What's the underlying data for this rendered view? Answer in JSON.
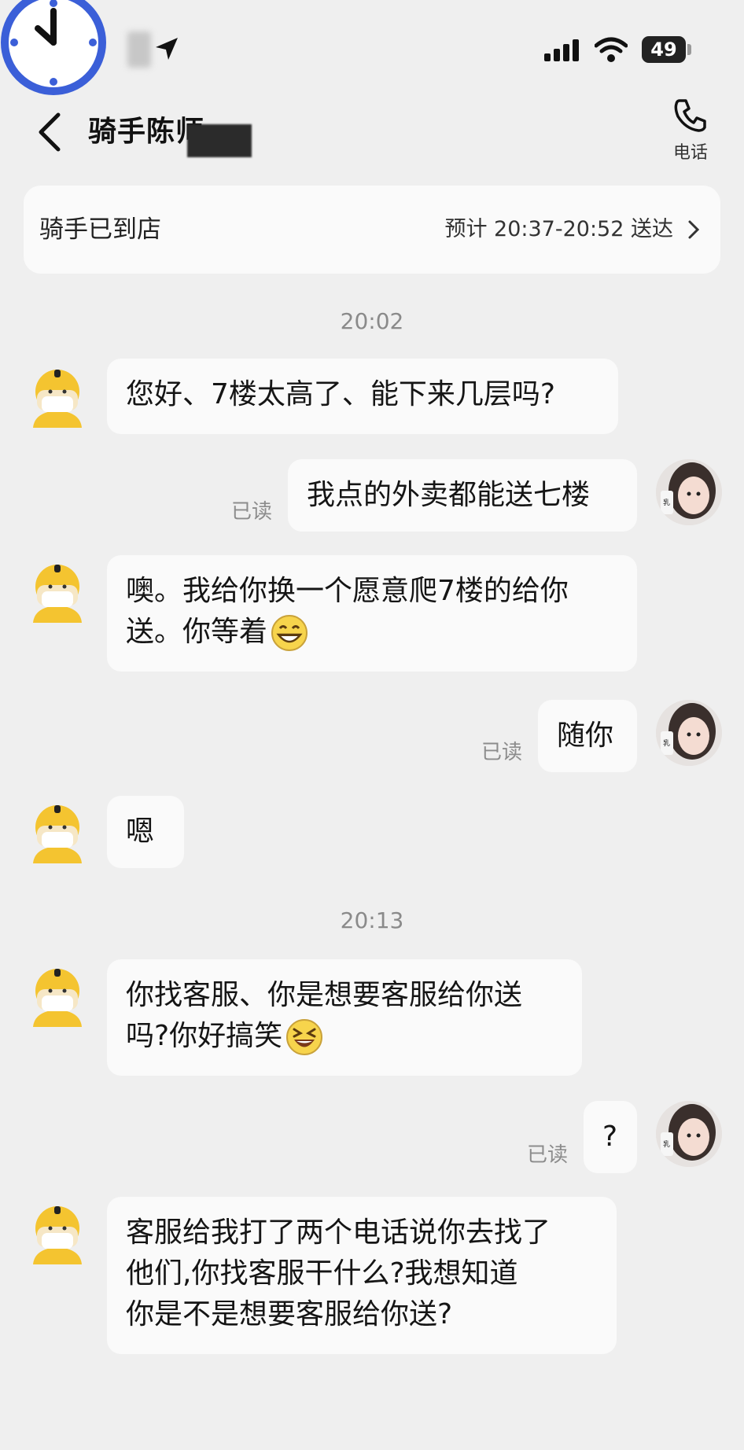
{
  "status_bar": {
    "battery": "49",
    "icons": [
      "clock-icon",
      "location-arrow-icon",
      "signal-icon",
      "wifi-icon",
      "battery-icon"
    ]
  },
  "header": {
    "title": "骑手陈师",
    "phone_label": "电话"
  },
  "status_card": {
    "status": "骑手已到店",
    "eta": "预计 20:37-20:52 送达"
  },
  "messages": [
    {
      "type": "time",
      "text": "20:02"
    },
    {
      "type": "rider",
      "text": "您好、7楼太高了、能下来几层吗?"
    },
    {
      "type": "user",
      "text": "我点的外卖都能送七楼",
      "read": "已读"
    },
    {
      "type": "rider",
      "line1": "噢。我给你换一个愿意爬7楼的给你",
      "line2": "送。你等着",
      "emoji": "grin-emoji"
    },
    {
      "type": "user",
      "text": "随你",
      "read": "已读"
    },
    {
      "type": "rider",
      "text": "嗯"
    },
    {
      "type": "time",
      "text": "20:13"
    },
    {
      "type": "rider",
      "line1": "你找客服、你是想要客服给你送",
      "line2": "吗?你好搞笑",
      "emoji": "laughing-emoji"
    },
    {
      "type": "user",
      "text": "?",
      "read": "已读"
    },
    {
      "type": "rider",
      "line1": "客服给我打了两个电话说你去找了",
      "line2": "他们,你找客服干什么?我想知道",
      "line3": "你是不是想要客服给你送?"
    }
  ],
  "colors": {
    "background": "#efefef",
    "bubble": "#fafafa",
    "clock_ring": "#3b5fd8",
    "rider_helmet": "#f4c430"
  }
}
